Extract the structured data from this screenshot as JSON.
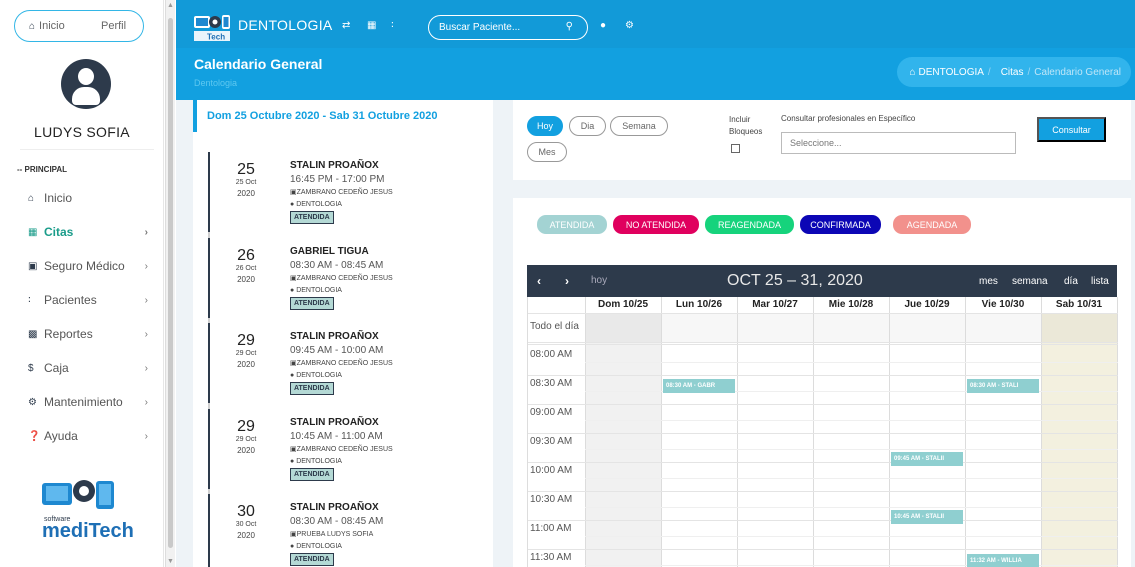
{
  "sidebar": {
    "pill_home": "Inicio",
    "pill_profile": "Perfil",
    "user_name": "LUDYS SOFIA",
    "section": "-- PRINCIPAL",
    "items": [
      {
        "label": "Inicio",
        "icon": "home-icon"
      },
      {
        "label": "Citas",
        "icon": "calendar-icon",
        "active": true
      },
      {
        "label": "Seguro Médico",
        "icon": "briefcase-icon"
      },
      {
        "label": "Pacientes",
        "icon": "users-icon"
      },
      {
        "label": "Reportes",
        "icon": "folder-icon"
      },
      {
        "label": "Caja",
        "icon": "dollar-icon"
      },
      {
        "label": "Mantenimiento",
        "icon": "gear-icon"
      },
      {
        "label": "Ayuda",
        "icon": "question-icon"
      }
    ],
    "logo_small": "software",
    "logo_text": "mediTech"
  },
  "topbar": {
    "brand": "DENTOLOGIA",
    "brand_logo_text": "Tech",
    "search_placeholder": "Buscar Paciente..."
  },
  "header": {
    "title": "Calendario General",
    "subtitle": "Dentologia",
    "breadcrumb": [
      "DENTOLOGIA",
      "Citas",
      "Calendario General"
    ],
    "breadcrumb_sep": "/"
  },
  "agenda": {
    "range": "Dom 25 Octubre 2020 - Sab 31 Octubre 2020",
    "events": [
      {
        "day": "25",
        "mon": "25 Oct",
        "year": "2020",
        "patient": "STALIN PROAÑOX",
        "time": "16:45 PM - 17:00 PM",
        "doctor": "ZAMBRANO CEDEÑO JESUS",
        "place": "DENTOLOGIA",
        "status": "ATENDIDA"
      },
      {
        "day": "26",
        "mon": "26 Oct",
        "year": "2020",
        "patient": "GABRIEL TIGUA",
        "time": "08:30 AM - 08:45 AM",
        "doctor": "ZAMBRANO CEDEÑO JESUS",
        "place": "DENTOLOGIA",
        "status": "ATENDIDA"
      },
      {
        "day": "29",
        "mon": "29 Oct",
        "year": "2020",
        "patient": "STALIN PROAÑOX",
        "time": "09:45 AM - 10:00 AM",
        "doctor": "ZAMBRANO CEDEÑO JESUS",
        "place": "DENTOLOGIA",
        "status": "ATENDIDA"
      },
      {
        "day": "29",
        "mon": "29 Oct",
        "year": "2020",
        "patient": "STALIN PROAÑOX",
        "time": "10:45 AM - 11:00 AM",
        "doctor": "ZAMBRANO CEDEÑO JESUS",
        "place": "DENTOLOGIA",
        "status": "ATENDIDA"
      },
      {
        "day": "30",
        "mon": "30 Oct",
        "year": "2020",
        "patient": "STALIN PROAÑOX",
        "time": "08:30 AM - 08:45 AM",
        "doctor": "PRUEBA LUDYS SOFIA",
        "place": "DENTOLOGIA",
        "status": "ATENDIDA"
      }
    ]
  },
  "filters": {
    "views": [
      "Hoy",
      "Dia",
      "Semana",
      "Mes"
    ],
    "include_label_1": "Incluir",
    "include_label_2": "Bloqueos",
    "prof_label": "Consultar profesionales en Específico",
    "prof_placeholder": "Seleccione...",
    "consult_button": "Consultar"
  },
  "legend": [
    {
      "label": "ATENDIDA",
      "bg": "#a3d3d3",
      "fg": "#ffffff"
    },
    {
      "label": "NO ATENDIDA",
      "bg": "#e0005e",
      "fg": "#ffffff"
    },
    {
      "label": "REAGENDADA",
      "bg": "#16d37c",
      "fg": "#ffffff"
    },
    {
      "label": "CONFIRMADA",
      "bg": "#0c06b5",
      "fg": "#ffffff"
    },
    {
      "label": "AGENDADA",
      "bg": "#f2918c",
      "fg": "#ffffff"
    }
  ],
  "calendar": {
    "today_label": "hoy",
    "title": "OCT 25 – 31, 2020",
    "views": [
      "mes",
      "semana",
      "día",
      "lista"
    ],
    "columns": [
      "Dom 10/25",
      "Lun 10/26",
      "Mar 10/27",
      "Mie 10/28",
      "Jue 10/29",
      "Vie 10/30",
      "Sab 10/31"
    ],
    "allday_label": "Todo el día",
    "times": [
      "08:00 AM",
      "08:30 AM",
      "09:00 AM",
      "09:30 AM",
      "10:00 AM",
      "10:30 AM",
      "11:00 AM",
      "11:30 AM"
    ],
    "events": [
      {
        "col": 1,
        "slot": 1,
        "label": "08:30 AM - GABR"
      },
      {
        "col": 5,
        "slot": 1,
        "label": "08:30 AM - STALI"
      },
      {
        "col": 4,
        "slot": 3.5,
        "label": "09:45 AM - STALII"
      },
      {
        "col": 4,
        "slot": 5.5,
        "label": "10:45 AM - STALII"
      },
      {
        "col": 5,
        "slot": 7.05,
        "label": "11:32 AM - WILLIA"
      }
    ]
  }
}
